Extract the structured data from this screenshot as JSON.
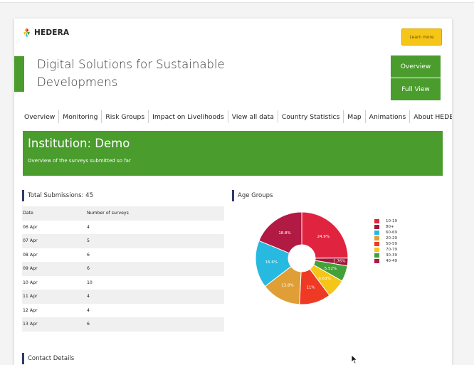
{
  "header": {
    "brand": "HEDERA",
    "learn_more": "Learn more",
    "title": "Digital Solutions for Sustainable Developmens",
    "overview_btn": "Overview",
    "full_view_btn": "Full View"
  },
  "nav": [
    "Overview",
    "Monitoring",
    "Risk Groups",
    "Impact on Livelihoods",
    "View all data",
    "Country Statistics",
    "Map",
    "Animations",
    "About HEDERA"
  ],
  "banner": {
    "title": "Institution: Demo",
    "subtitle": "Overview of the surveys submitted so far"
  },
  "submissions": {
    "title": "Total Submissions: 45",
    "columns": [
      "Date",
      "Number of surveys"
    ],
    "rows": [
      [
        "06 Apr",
        "4"
      ],
      [
        "07 Apr",
        "5"
      ],
      [
        "08 Apr",
        "6"
      ],
      [
        "09 Apr",
        "6"
      ],
      [
        "10 Apr",
        "10"
      ],
      [
        "11 Apr",
        "4"
      ],
      [
        "12 Apr",
        "4"
      ],
      [
        "13 Apr",
        "6"
      ]
    ]
  },
  "age_groups": {
    "title": "Age Groups"
  },
  "contact": {
    "title": "Contact Details"
  },
  "chart_data": {
    "type": "pie",
    "donut": true,
    "title": "Age Groups",
    "slices": [
      {
        "label": "10-19",
        "value": 24.9,
        "display": "24.9%",
        "color": "#e0243f"
      },
      {
        "label": "80+",
        "value": 2.76,
        "display": "2.76%",
        "color": "#a3173a"
      },
      {
        "label": "60-69",
        "value": 16.6,
        "display": "16.6%",
        "color": "#27b9e0"
      },
      {
        "label": "20-29",
        "value": 13.8,
        "display": "13.8%",
        "color": "#df9f36"
      },
      {
        "label": "50-59",
        "value": 11,
        "display": "11%",
        "color": "#ee3a24"
      },
      {
        "label": "70-79",
        "value": 6.63,
        "display": "6.63%",
        "color": "#f5c518"
      },
      {
        "label": "30-39",
        "value": 5.52,
        "display": "5.52%",
        "color": "#44a038"
      },
      {
        "label": "40-49",
        "value": 18.8,
        "display": "18.8%",
        "color": "#b11a43"
      }
    ],
    "clockwise_order": [
      "10-19",
      "80+",
      "30-39",
      "70-79",
      "50-59",
      "20-29",
      "60-69",
      "40-49"
    ],
    "legend_position": "right"
  },
  "colors": {
    "brand_green": "#4a9c2d",
    "learn_yellow": "#f5c518",
    "section_accent": "#2e3b67"
  }
}
